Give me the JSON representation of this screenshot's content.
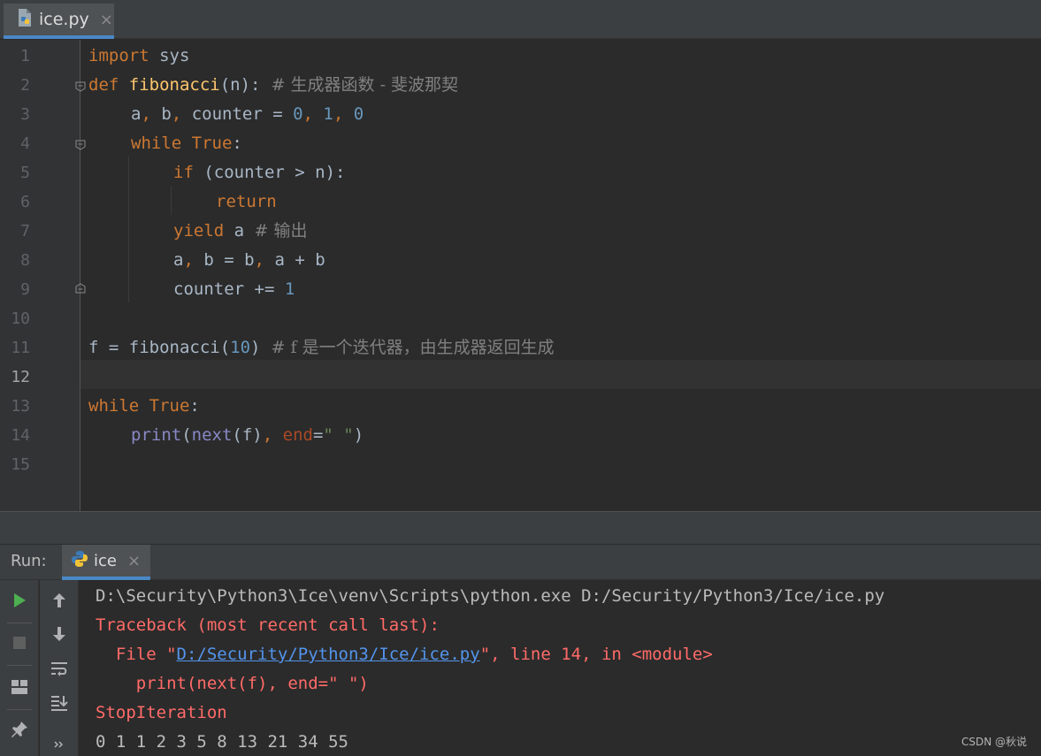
{
  "editor_tab": {
    "filename": "ice.py",
    "close": "×"
  },
  "gutter": {
    "line_numbers": [
      "1",
      "2",
      "3",
      "4",
      "5",
      "6",
      "7",
      "8",
      "9",
      "10",
      "11",
      "12",
      "13",
      "14",
      "15"
    ]
  },
  "code": {
    "l1": {
      "kw": "import",
      "rest": " sys"
    },
    "l2": {
      "kw": "def",
      "fn": "fibonacci",
      "params": "(n):",
      "comment": "  # 生成器函数 - 斐波那契"
    },
    "l3": {
      "a": "a",
      "c1": ", ",
      "b": "b",
      "c2": ", ",
      "rest": "counter = ",
      "n0": "0",
      "c3": ", ",
      "n1": "1",
      "c4": ", ",
      "n2": "0"
    },
    "l4": {
      "kw": "while",
      "kw2": "True",
      "rest": ":"
    },
    "l5": {
      "kw": "if",
      "rest": " (counter > n):"
    },
    "l6": {
      "kw": "return"
    },
    "l7": {
      "kw": "yield",
      "rest": " a ",
      "comment": "# 输出"
    },
    "l8": {
      "a": "a",
      "c1": ", ",
      "rest1": "b = b",
      "c2": ", ",
      "rest2": "a + b"
    },
    "l9": {
      "rest": "counter += ",
      "num": "1"
    },
    "l11": {
      "rest": "f = fibonacci(",
      "num": "10",
      "close": ")",
      "comment": "  # f 是一个迭代器，由生成器返回生成"
    },
    "l13": {
      "kw": "while",
      "kw2": "True",
      "rest": ":"
    },
    "l14": {
      "bi": "print",
      "p1": "(",
      "bi2": "next",
      "p2": "(f)",
      "c": ", ",
      "kwarg": "end",
      "eq": "=",
      "str": "\" \"",
      "p3": ")"
    }
  },
  "run_panel": {
    "label": "Run:",
    "tab": "ice",
    "close": "×",
    "console": {
      "cmd": "D:\\Security\\Python3\\Ice\\venv\\Scripts\\python.exe D:/Security/Python3/Ice/ice.py",
      "traceback": "Traceback (most recent call last):",
      "file_prefix": "  File \"",
      "file_link": "D:/Security/Python3/Ice/ice.py",
      "file_suffix": "\", line 14, in <module>",
      "src": "    print(next(f), end=\" \")",
      "error": "StopIteration",
      "output": "0 1 1 2 3 5 8 13 21 34 55"
    }
  },
  "watermark": "CSDN @秋说",
  "colors": {
    "keyword": "#cc7832",
    "function": "#ffc66d",
    "number": "#6897bb",
    "comment": "#808080",
    "error": "#ff6b68",
    "link": "#5394ec",
    "run_green": "#4caf50"
  }
}
